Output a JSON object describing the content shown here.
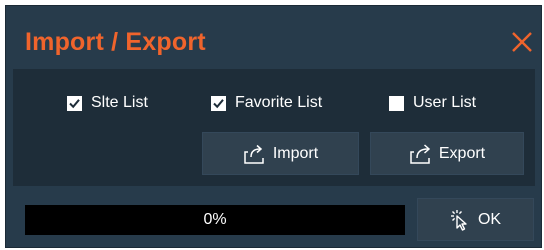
{
  "dialog": {
    "title": "Import / Export",
    "accent_color": "#f0642c",
    "background_color": "#273b4b"
  },
  "options": [
    {
      "label": "Slte List",
      "checked": true
    },
    {
      "label": "Favorite List",
      "checked": true
    },
    {
      "label": "User List",
      "checked": false
    }
  ],
  "buttons": {
    "import_label": "Import",
    "import_icon": "import-icon",
    "export_label": "Export",
    "export_icon": "export-icon",
    "ok_label": "OK",
    "ok_icon": "click-cursor-icon"
  },
  "progress": {
    "text": "0%",
    "fraction": 0
  }
}
